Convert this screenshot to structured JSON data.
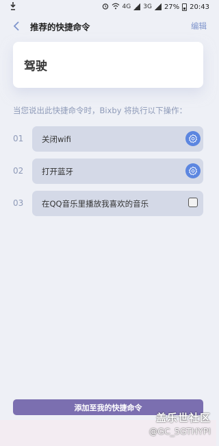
{
  "status_bar": {
    "left_icon": "download-icon",
    "indicators": [
      "alarm-icon",
      "wifi-icon",
      "4G",
      "3G"
    ],
    "battery": "27%",
    "time": "20:43"
  },
  "header": {
    "title": "推荐的快捷命令",
    "edit_label": "编辑"
  },
  "command_name": "驾驶",
  "description": "当您说出此快捷命令时，Bixby 将执行以下操作：",
  "actions": [
    {
      "num": "01",
      "label": "关闭wifi",
      "icon": "gear-icon"
    },
    {
      "num": "02",
      "label": "打开蓝牙",
      "icon": "gear-icon"
    },
    {
      "num": "03",
      "label": "在QQ音乐里播放我喜欢的音乐",
      "icon": "app-icon"
    }
  ],
  "add_button_label": "添加至我的快捷命令",
  "watermark": {
    "title": "盖乐世社区",
    "user": "@GC_5GTHYPI"
  },
  "colors": {
    "background": "#eef0f6",
    "accent": "#5c86e0",
    "button": "#7b6fb0"
  }
}
